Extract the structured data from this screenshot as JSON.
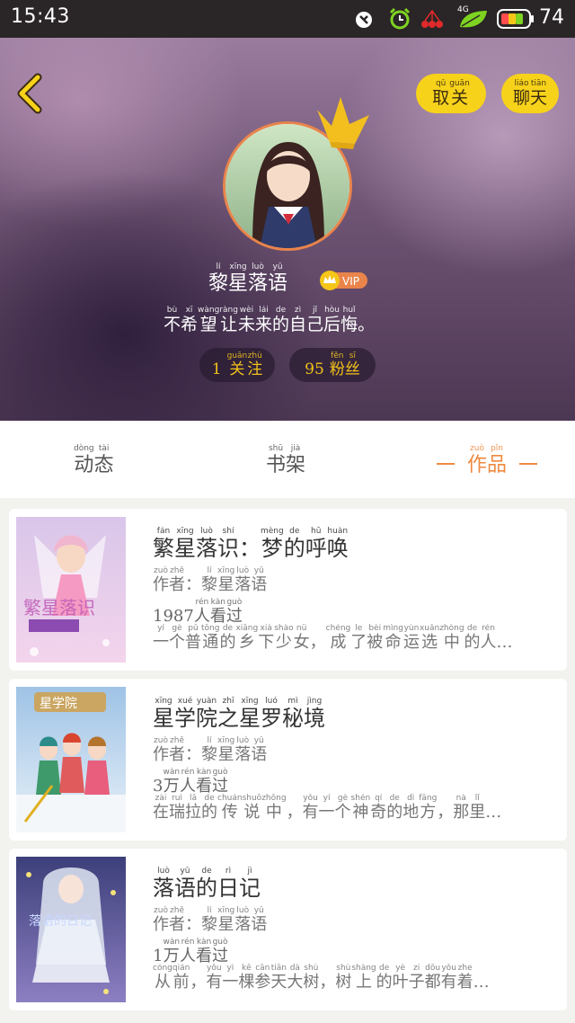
{
  "status_bar": {
    "time": "15:43",
    "network": "4G",
    "battery_level": "74",
    "icons": [
      "notification-icon",
      "alarm-icon",
      "cherry-icon",
      "leaf-icon",
      "battery-icon"
    ]
  },
  "header": {
    "unfollow_label": "取关",
    "unfollow_pinyin": [
      "qǔ",
      "guān"
    ],
    "chat_label": "聊天",
    "chat_pinyin": [
      "liáo",
      "tiān"
    ],
    "username": "黎星落语",
    "username_pinyin": [
      "lí",
      "xīng",
      "luò",
      "yǔ"
    ],
    "vip_label": "VIP",
    "motto": "不希望让未来的自己后悔。",
    "motto_pinyin": [
      "bù",
      "xī",
      "wàng",
      "ràng",
      "wèi",
      "lái",
      "de",
      "zì",
      "jǐ",
      "hòu",
      "huǐ",
      ""
    ],
    "following_count": "1",
    "following_label": "关注",
    "following_pinyin": [
      "guān",
      "zhù"
    ],
    "fans_count": "95",
    "fans_label": "粉丝",
    "fans_pinyin": [
      "fěn",
      "sī"
    ]
  },
  "tabs": [
    {
      "label": "动态",
      "pinyin": [
        "dòng",
        "tài"
      ],
      "active": false
    },
    {
      "label": "书架",
      "pinyin": [
        "shū",
        "jià"
      ],
      "active": false
    },
    {
      "label": "作品",
      "pinyin": [
        "zuò",
        "pǐn"
      ],
      "active": true
    }
  ],
  "works": [
    {
      "title": "繁星落识：梦的呼唤",
      "title_pinyin": [
        "fán",
        "xīng",
        "luò",
        "shí",
        "",
        "mèng",
        "de",
        "hū",
        "huàn"
      ],
      "author": "作者：黎星落语",
      "author_pinyin": [
        "zuò",
        "zhě",
        "",
        "lí",
        "xīng",
        "luò",
        "yǔ"
      ],
      "views": "1987人看过",
      "views_pinyin": [
        "",
        "",
        "",
        "",
        "rén",
        "kàn",
        "guò"
      ],
      "desc": "一个普通的乡下少女，成了被命运选中的人…",
      "desc_pinyin": [
        "yí",
        "gè",
        "pǔ",
        "tōng",
        "de",
        "xiāng",
        "xià",
        "shào",
        "nǚ",
        "",
        "chéng",
        "le",
        "bèi",
        "mìng",
        "yùn",
        "xuǎn",
        "zhòng",
        "de",
        "rén",
        ""
      ]
    },
    {
      "title": "星学院之星罗秘境",
      "title_pinyin": [
        "xīng",
        "xué",
        "yuàn",
        "zhī",
        "xīng",
        "luó",
        "mì",
        "jìng"
      ],
      "author": "作者：黎星落语",
      "author_pinyin": [
        "zuò",
        "zhě",
        "",
        "lí",
        "xīng",
        "luò",
        "yǔ"
      ],
      "views": "3万人看过",
      "views_pinyin": [
        "",
        "wàn",
        "rén",
        "kàn",
        "guò"
      ],
      "desc": "在瑞拉的传说中，有一个神奇的地方，那里…",
      "desc_pinyin": [
        "zài",
        "ruì",
        "lā",
        "de",
        "chuán",
        "shuō",
        "zhōng",
        "",
        "yǒu",
        "yí",
        "gè",
        "shén",
        "qí",
        "de",
        "dì",
        "fāng",
        "",
        "nà",
        "lǐ",
        ""
      ]
    },
    {
      "title": "落语的日记",
      "title_pinyin": [
        "luò",
        "yǔ",
        "de",
        "rì",
        "jì"
      ],
      "author": "作者：黎星落语",
      "author_pinyin": [
        "zuò",
        "zhě",
        "",
        "lí",
        "xīng",
        "luò",
        "yǔ"
      ],
      "views": "1万人看过",
      "views_pinyin": [
        "",
        "wàn",
        "rén",
        "kàn",
        "guò"
      ],
      "desc": "从前，有一棵参天大树，树上的叶子都有着…",
      "desc_pinyin": [
        "cóng",
        "qián",
        "",
        "yǒu",
        "yì",
        "kē",
        "cān",
        "tiān",
        "dà",
        "shù",
        "",
        "shù",
        "shàng",
        "de",
        "yè",
        "zi",
        "dōu",
        "yǒu",
        "zhe",
        ""
      ]
    }
  ],
  "colors": {
    "accent": "#ee8a40",
    "pill": "#f7d21a",
    "stat_text": "#f2c21a",
    "vip": "#e9844b"
  }
}
